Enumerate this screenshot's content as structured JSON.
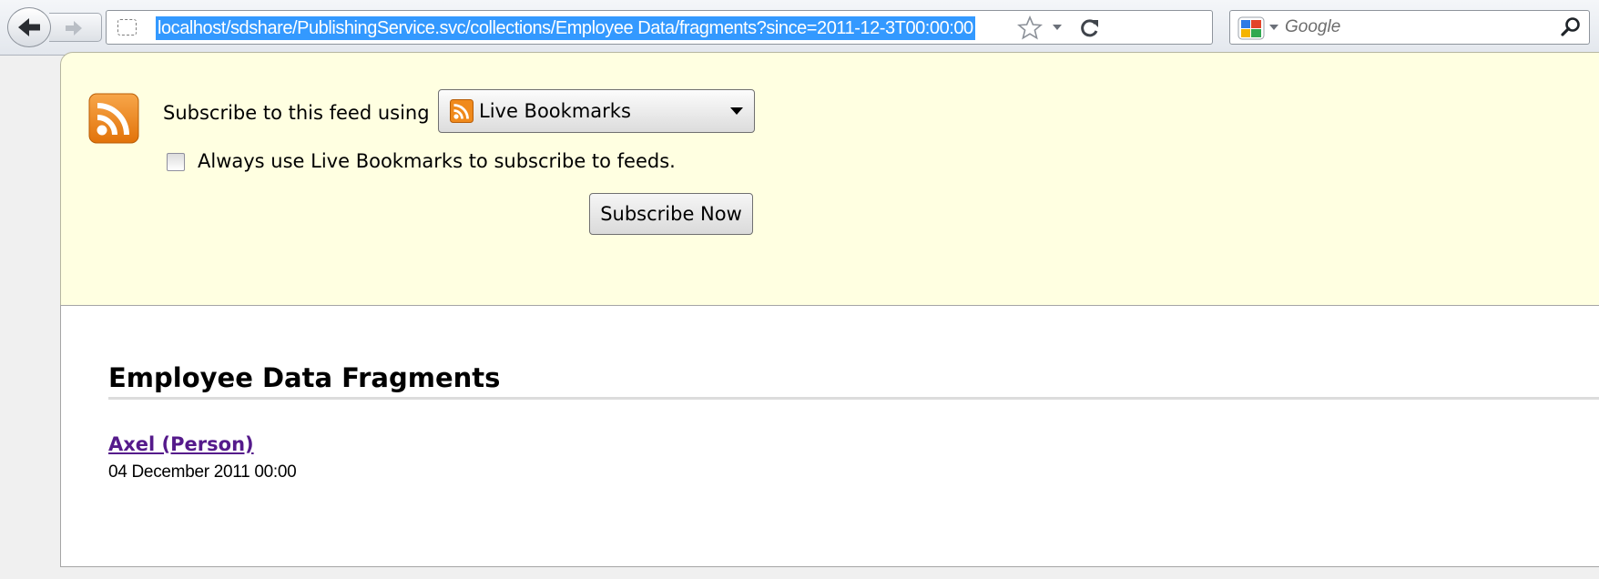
{
  "browser": {
    "url": "localhost/sdshare/PublishingService.svc/collections/Employee Data/fragments?since=2011-12-3T00:00:00",
    "search_placeholder": "Google",
    "icons": {
      "back": "back-arrow-icon",
      "forward": "forward-arrow-icon",
      "identity": "site-identity-icon",
      "bookmark": "bookmark-star-icon",
      "url_dropdown": "chevron-down-icon",
      "reload": "reload-icon",
      "search_engine": "google-icon",
      "search": "magnifier-icon"
    }
  },
  "subscribe": {
    "label": "Subscribe to this feed using",
    "reader_selected": "Live Bookmarks",
    "always_use_label": "Always use Live Bookmarks to subscribe to feeds.",
    "always_use_checked": false,
    "subscribe_button": "Subscribe Now",
    "icon": "rss-feed-icon"
  },
  "feed": {
    "title": "Employee Data Fragments",
    "entries": [
      {
        "title": "Axel (Person)",
        "date": "04 December 2011 00:00"
      }
    ]
  },
  "colors": {
    "url_selection": "#3399ff",
    "panel_background": "#ffffe1",
    "visited_link": "#551a8b",
    "rss_orange": "#f38b1f"
  }
}
